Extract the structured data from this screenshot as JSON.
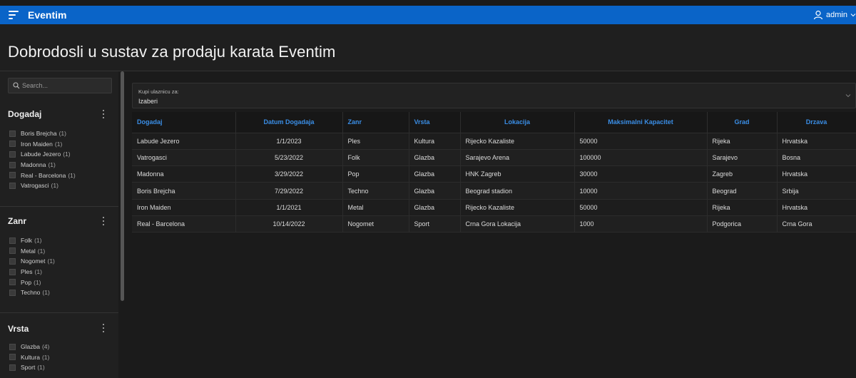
{
  "app": {
    "title": "Eventim",
    "user": "admin"
  },
  "page": {
    "title": "Dobrodosli u sustav za prodaju karata Eventim"
  },
  "sidebar": {
    "search_placeholder": "Search...",
    "facets": [
      {
        "title": "Dogadaj",
        "items": [
          {
            "label": "Boris Brejcha",
            "count": "(1)"
          },
          {
            "label": "Iron Maiden",
            "count": "(1)"
          },
          {
            "label": "Labude Jezero",
            "count": "(1)"
          },
          {
            "label": "Madonna",
            "count": "(1)"
          },
          {
            "label": "Real - Barcelona",
            "count": "(1)"
          },
          {
            "label": "Vatrogasci",
            "count": "(1)"
          }
        ]
      },
      {
        "title": "Zanr",
        "items": [
          {
            "label": "Folk",
            "count": "(1)"
          },
          {
            "label": "Metal",
            "count": "(1)"
          },
          {
            "label": "Nogomet",
            "count": "(1)"
          },
          {
            "label": "Ples",
            "count": "(1)"
          },
          {
            "label": "Pop",
            "count": "(1)"
          },
          {
            "label": "Techno",
            "count": "(1)"
          }
        ]
      },
      {
        "title": "Vrsta",
        "items": [
          {
            "label": "Glazba",
            "count": "(4)"
          },
          {
            "label": "Kultura",
            "count": "(1)"
          },
          {
            "label": "Sport",
            "count": "(1)"
          }
        ]
      }
    ]
  },
  "ticket_select": {
    "label": "Kupi ulaznicu za:",
    "value": "Izaberi"
  },
  "table": {
    "headers": [
      "Dogadaj",
      "Datum Dogadaja",
      "Zanr",
      "Vrsta",
      "Lokacija",
      "Maksimalni Kapacitet",
      "Grad",
      "Drzava"
    ],
    "rows": [
      [
        "Labude Jezero",
        "1/1/2023",
        "Ples",
        "Kultura",
        "Rijecko Kazaliste",
        "50000",
        "Rijeka",
        "Hrvatska"
      ],
      [
        "Vatrogasci",
        "5/23/2022",
        "Folk",
        "Glazba",
        "Sarajevo Arena",
        "100000",
        "Sarajevo",
        "Bosna"
      ],
      [
        "Madonna",
        "3/29/2022",
        "Pop",
        "Glazba",
        "HNK Zagreb",
        "30000",
        "Zagreb",
        "Hrvatska"
      ],
      [
        "Boris Brejcha",
        "7/29/2022",
        "Techno",
        "Glazba",
        "Beograd stadion",
        "10000",
        "Beograd",
        "Srbija"
      ],
      [
        "Iron Maiden",
        "1/1/2021",
        "Metal",
        "Glazba",
        "Rijecko Kazaliste",
        "50000",
        "Rijeka",
        "Hrvatska"
      ],
      [
        "Real - Barcelona",
        "10/14/2022",
        "Nogomet",
        "Sport",
        "Crna Gora Lokacija",
        "1000",
        "Podgorica",
        "Crna Gora"
      ]
    ]
  },
  "colors": {
    "topbar": "#0a64c8",
    "header_text": "#3a8ee6",
    "background": "#1b1b1b"
  }
}
